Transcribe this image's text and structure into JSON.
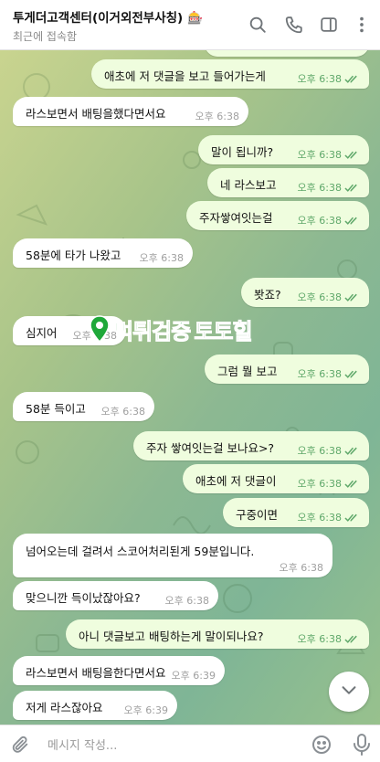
{
  "header": {
    "title": "투게더고객센터(이거외전부사칭)",
    "title_badge": "🎰",
    "status": "최근에 접속함",
    "icons": [
      "search-icon",
      "phone-icon",
      "sidebar-icon",
      "more-icon"
    ]
  },
  "messages": [
    {
      "dir": "out",
      "text": "애초에 저 댓글을 보고 들어가는게",
      "time": "오후 6:38"
    },
    {
      "dir": "in",
      "text": "라스보면서 배팅을했다면서요",
      "time": "오후 6:38"
    },
    {
      "dir": "out",
      "text": "말이 됩니까?",
      "time": "오후 6:38"
    },
    {
      "dir": "out",
      "text": "네 라스보고",
      "time": "오후 6:38"
    },
    {
      "dir": "out",
      "text": "주자쌓여잇는걸",
      "time": "오후 6:38"
    },
    {
      "dir": "in",
      "text": "58분에 타가 나왔고",
      "time": "오후 6:38"
    },
    {
      "dir": "out",
      "text": "봣죠?",
      "time": "오후 6:38"
    },
    {
      "dir": "in",
      "text": "심지어",
      "time": "오후 6:38"
    },
    {
      "dir": "out",
      "text": "그럼 뭘 보고",
      "time": "오후 6:38"
    },
    {
      "dir": "in",
      "text": "58분 득이고",
      "time": "오후 6:38"
    },
    {
      "dir": "out",
      "text": "주자 쌓여잇는걸 보나요>?",
      "time": "오후 6:38"
    },
    {
      "dir": "out",
      "text": "애초에 저 댓글이",
      "time": "오후 6:38"
    },
    {
      "dir": "out",
      "text": "구중이면",
      "time": "오후 6:38"
    },
    {
      "dir": "in",
      "text": "넘어오는데 걸려서 스코어처리된게 59분입니다.",
      "time": "오후 6:38"
    },
    {
      "dir": "in",
      "text": "맞으니깐 득이났잖아요?",
      "time": "오후 6:38"
    },
    {
      "dir": "out",
      "text": "아니 댓글보고 배팅하는게 말이되나요?",
      "time": "오후 6:38"
    },
    {
      "dir": "in",
      "text": "라스보면서 배팅을한다면서요",
      "time": "오후 6:39"
    },
    {
      "dir": "in",
      "text": "저게 라스잖아요",
      "time": "오후 6:39"
    }
  ],
  "watermark": {
    "part1": "먹튀검증",
    "part2": "토토힐"
  },
  "composer": {
    "placeholder": "메시지 작성..."
  },
  "colors": {
    "outgoing": "#effdde",
    "incoming": "#ffffff",
    "check": "#5fa86a",
    "accent": "#1fa83a"
  }
}
